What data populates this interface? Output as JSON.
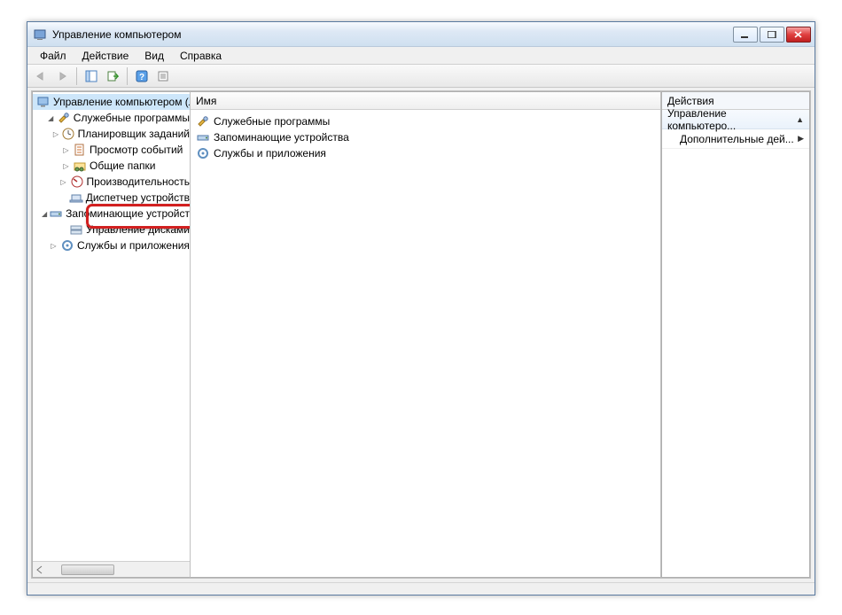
{
  "window": {
    "title": "Управление компьютером"
  },
  "menu": {
    "items": [
      "Файл",
      "Действие",
      "Вид",
      "Справка"
    ]
  },
  "left": {
    "root": "Управление компьютером (л",
    "grp1": "Служебные программы",
    "n1": "Планировщик заданий",
    "n2": "Просмотр событий",
    "n3": "Общие папки",
    "n4": "Производительность",
    "n5": "Диспетчер устройств",
    "grp2": "Запоминающие устройст",
    "n6": "Управление дисками",
    "grp3": "Службы и приложения"
  },
  "center": {
    "header": "Имя",
    "rows": [
      "Служебные программы",
      "Запоминающие устройства",
      "Службы и приложения"
    ]
  },
  "right": {
    "header": "Действия",
    "group": "Управление компьютеро...",
    "item": "Дополнительные дей..."
  }
}
